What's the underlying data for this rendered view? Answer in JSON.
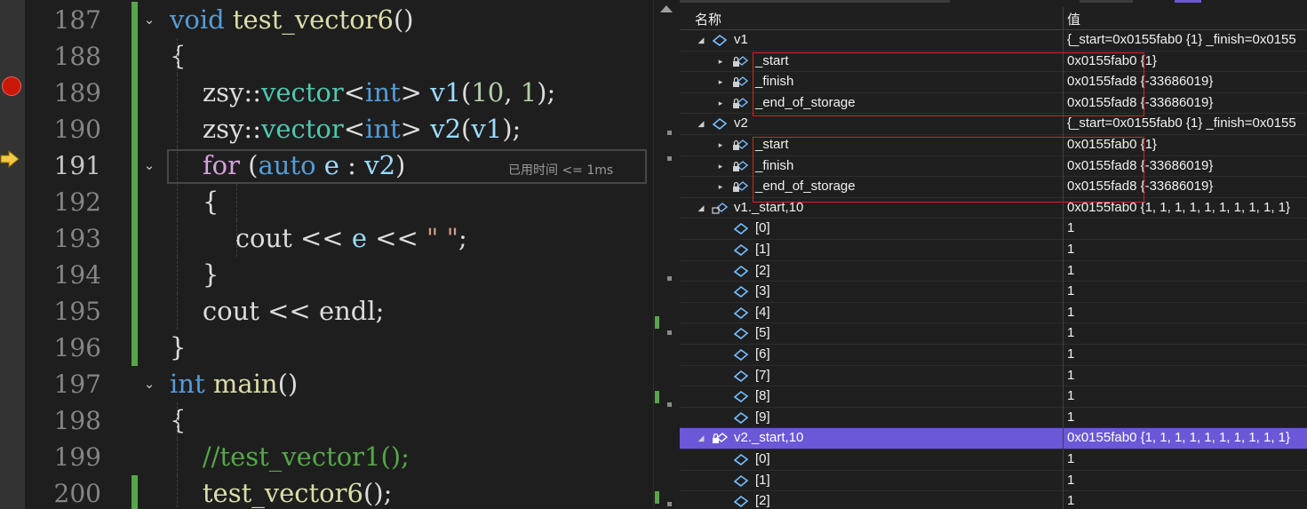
{
  "editor": {
    "lines": [
      {
        "num": "187",
        "parts": [
          [
            "kw",
            "void"
          ],
          [
            "t",
            " "
          ],
          [
            "fn",
            "test_vector6"
          ],
          [
            "t",
            "()"
          ]
        ],
        "fold": true,
        "changed": true
      },
      {
        "num": "188",
        "parts": [
          [
            "t",
            "{"
          ]
        ],
        "changed": true
      },
      {
        "num": "189",
        "parts": [
          [
            "t",
            "    zsy::"
          ],
          [
            "ty",
            "vector"
          ],
          [
            "t",
            "<"
          ],
          [
            "kw",
            "int"
          ],
          [
            "t",
            "> "
          ],
          [
            "vr",
            "v1"
          ],
          [
            "t",
            "("
          ],
          [
            "nm",
            "10"
          ],
          [
            "t",
            ", "
          ],
          [
            "nm",
            "1"
          ],
          [
            "t",
            ");"
          ]
        ],
        "changed": true,
        "breakpoint": true
      },
      {
        "num": "190",
        "parts": [
          [
            "t",
            "    zsy::"
          ],
          [
            "ty",
            "vector"
          ],
          [
            "t",
            "<"
          ],
          [
            "kw",
            "int"
          ],
          [
            "t",
            "> "
          ],
          [
            "vr",
            "v2"
          ],
          [
            "t",
            "("
          ],
          [
            "vr",
            "v1"
          ],
          [
            "t",
            ");"
          ]
        ],
        "changed": true
      },
      {
        "num": "191",
        "parts": [
          [
            "t",
            "    "
          ],
          [
            "ctl",
            "for"
          ],
          [
            "t",
            " ("
          ],
          [
            "kw",
            "auto"
          ],
          [
            "t",
            " "
          ],
          [
            "vr",
            "e"
          ],
          [
            "t",
            " : "
          ],
          [
            "vr",
            "v2"
          ],
          [
            "t",
            ")"
          ]
        ],
        "fold": true,
        "changed": true,
        "current": true
      },
      {
        "num": "192",
        "parts": [
          [
            "t",
            "    {"
          ]
        ],
        "changed": true
      },
      {
        "num": "193",
        "parts": [
          [
            "t",
            "        cout << "
          ],
          [
            "vr",
            "e"
          ],
          [
            "t",
            " << "
          ],
          [
            "st",
            "\" \""
          ],
          [
            "t",
            ";"
          ]
        ],
        "changed": true
      },
      {
        "num": "194",
        "parts": [
          [
            "t",
            "    }"
          ]
        ],
        "changed": true
      },
      {
        "num": "195",
        "parts": [
          [
            "t",
            "    cout << endl;"
          ]
        ],
        "changed": true
      },
      {
        "num": "196",
        "parts": [
          [
            "t",
            "}"
          ]
        ],
        "changed": true
      },
      {
        "num": "197",
        "parts": [
          [
            "kw",
            "int"
          ],
          [
            "t",
            " "
          ],
          [
            "fn",
            "main"
          ],
          [
            "t",
            "()"
          ]
        ],
        "fold": true
      },
      {
        "num": "198",
        "parts": [
          [
            "t",
            "{"
          ]
        ]
      },
      {
        "num": "199",
        "parts": [
          [
            "t",
            "    "
          ],
          [
            "cm",
            "//test_vector1();"
          ]
        ]
      },
      {
        "num": "200",
        "parts": [
          [
            "t",
            "    "
          ],
          [
            "fn",
            "test_vector6"
          ],
          [
            "t",
            "();"
          ]
        ],
        "changed": true
      }
    ],
    "perf_tip": "已用时间 <= 1ms",
    "breakpoint_color": "#e51400",
    "change_color": "#57a64a"
  },
  "watch": {
    "header_name": "名称",
    "header_value": "值",
    "selected_color": "#6a58d8",
    "rows": [
      {
        "name": "v1",
        "value": "{_start=0x0155fab0 {1} _finish=0x0155",
        "level": 0,
        "expander": "open",
        "icon": "object-icon"
      },
      {
        "name": "_start",
        "value": "0x0155fab0 {1}",
        "level": 1,
        "expander": "closed",
        "icon": "private-member-icon"
      },
      {
        "name": "_finish",
        "value": "0x0155fad8 {-33686019}",
        "level": 1,
        "expander": "closed",
        "icon": "private-member-icon"
      },
      {
        "name": "_end_of_storage",
        "value": "0x0155fad8 {-33686019}",
        "level": 1,
        "expander": "closed",
        "icon": "private-member-icon"
      },
      {
        "name": "v2",
        "value": "{_start=0x0155fab0 {1} _finish=0x0155",
        "level": 0,
        "expander": "open",
        "icon": "object-icon"
      },
      {
        "name": "_start",
        "value": "0x0155fab0 {1}",
        "level": 1,
        "expander": "closed",
        "icon": "private-member-icon"
      },
      {
        "name": "_finish",
        "value": "0x0155fad8 {-33686019}",
        "level": 1,
        "expander": "closed",
        "icon": "private-member-icon"
      },
      {
        "name": "_end_of_storage",
        "value": "0x0155fad8 {-33686019}",
        "level": 1,
        "expander": "closed",
        "icon": "private-member-icon"
      },
      {
        "name": "v1._start,10",
        "value": "0x0155fab0 {1, 1, 1, 1, 1, 1, 1, 1, 1, 1}",
        "level": 0,
        "expander": "open",
        "icon": "pointer-icon"
      },
      {
        "name": "[0]",
        "value": "1",
        "level": 1,
        "icon": "element-icon"
      },
      {
        "name": "[1]",
        "value": "1",
        "level": 1,
        "icon": "element-icon"
      },
      {
        "name": "[2]",
        "value": "1",
        "level": 1,
        "icon": "element-icon"
      },
      {
        "name": "[3]",
        "value": "1",
        "level": 1,
        "icon": "element-icon"
      },
      {
        "name": "[4]",
        "value": "1",
        "level": 1,
        "icon": "element-icon"
      },
      {
        "name": "[5]",
        "value": "1",
        "level": 1,
        "icon": "element-icon"
      },
      {
        "name": "[6]",
        "value": "1",
        "level": 1,
        "icon": "element-icon"
      },
      {
        "name": "[7]",
        "value": "1",
        "level": 1,
        "icon": "element-icon"
      },
      {
        "name": "[8]",
        "value": "1",
        "level": 1,
        "icon": "element-icon"
      },
      {
        "name": "[9]",
        "value": "1",
        "level": 1,
        "icon": "element-icon"
      },
      {
        "name": "v2._start,10",
        "value": "0x0155fab0 {1, 1, 1, 1, 1, 1, 1, 1, 1, 1}",
        "level": 0,
        "expander": "open",
        "icon": "locked-pointer-icon",
        "selected": true
      },
      {
        "name": "[0]",
        "value": "1",
        "level": 1,
        "icon": "element-icon"
      },
      {
        "name": "[1]",
        "value": "1",
        "level": 1,
        "icon": "element-icon"
      },
      {
        "name": "[2]",
        "value": "1",
        "level": 1,
        "icon": "element-icon"
      }
    ]
  }
}
